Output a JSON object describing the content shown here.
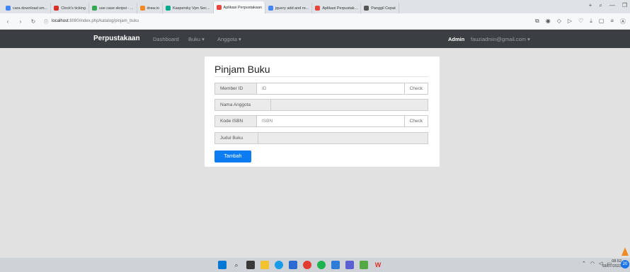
{
  "browser": {
    "tabs": [
      {
        "label": "cara download sm...",
        "color": "#4285f4"
      },
      {
        "label": "Clock's ticking",
        "color": "#d93025"
      },
      {
        "label": "use case skripsi - ...",
        "color": "#34a853"
      },
      {
        "label": "draw.io",
        "color": "#f08a24"
      },
      {
        "label": "Kaspersky Vpn Sec...",
        "color": "#00a88e"
      },
      {
        "label": "Aplikasi Perpustakaan",
        "color": "#e8453c",
        "active": true
      },
      {
        "label": "jquery add and re...",
        "color": "#4285f4"
      },
      {
        "label": "Aplikasi Perpustak...",
        "color": "#e8453c"
      },
      {
        "label": "Panggil Cepat",
        "color": "#555555"
      }
    ],
    "url_host": "localhost",
    "url_path": ":8080/index.php/katalog/pinjam_buku"
  },
  "navbar": {
    "brand": "Perpustakaan",
    "links": [
      {
        "label": "Dashboard"
      },
      {
        "label": "Buku ▾"
      },
      {
        "label": "Anggota ▾"
      }
    ],
    "admin_label": "Admin",
    "email_label": "fauziadmin@gmail.com ▾"
  },
  "form": {
    "title": "Pinjam Buku",
    "member_id_label": "Member ID",
    "member_id_placeholder": "ID",
    "check1_label": "Check",
    "nama_label": "Nama Anggota",
    "isbn_label": "Kode ISBN",
    "isbn_placeholder": "ISBN",
    "check2_label": "Check",
    "judul_label": "Judul Buku",
    "submit_label": "Tambah"
  },
  "taskbar": {
    "time": "08.52",
    "date": "18/07/2023",
    "notif_count": "20"
  }
}
